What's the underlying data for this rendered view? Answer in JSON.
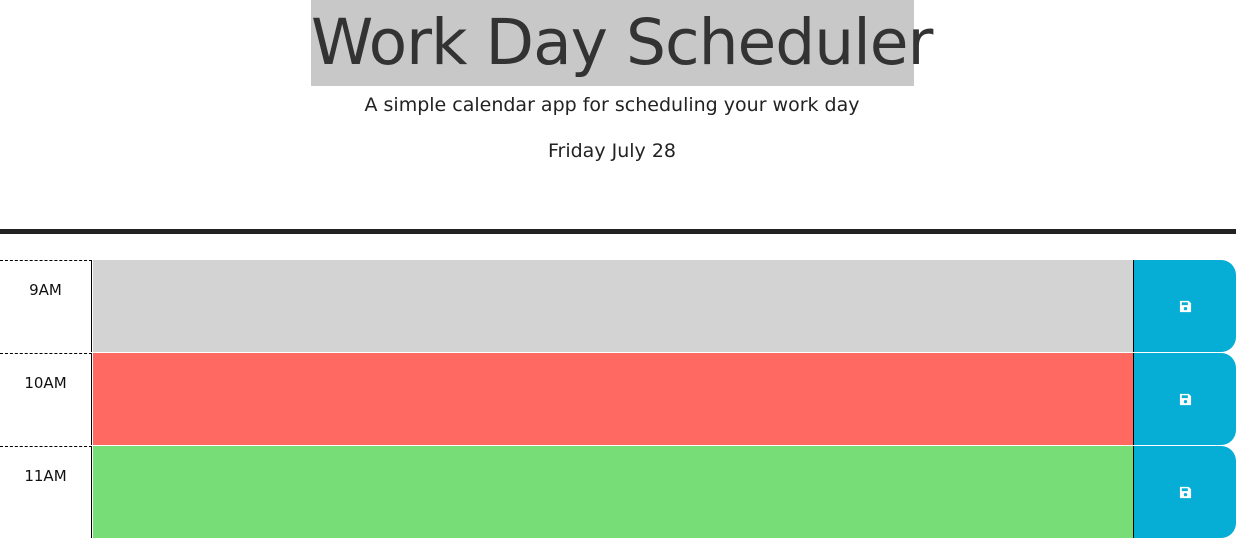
{
  "header": {
    "title": "Work Day Scheduler",
    "subtitle": "A simple calendar app for scheduling your work day",
    "current_day": "Friday July 28"
  },
  "colors": {
    "past": "#d3d3d3",
    "present": "#ff6961",
    "future": "#77dd77",
    "save_button": "#06aed5",
    "title_highlight": "#c8c8c8"
  },
  "timeblocks": [
    {
      "hour": "9AM",
      "state": "past",
      "text": "",
      "save_icon": "floppy-disk-icon"
    },
    {
      "hour": "10AM",
      "state": "present",
      "text": "",
      "save_icon": "floppy-disk-icon"
    },
    {
      "hour": "11AM",
      "state": "future",
      "text": "",
      "save_icon": "floppy-disk-icon"
    }
  ]
}
